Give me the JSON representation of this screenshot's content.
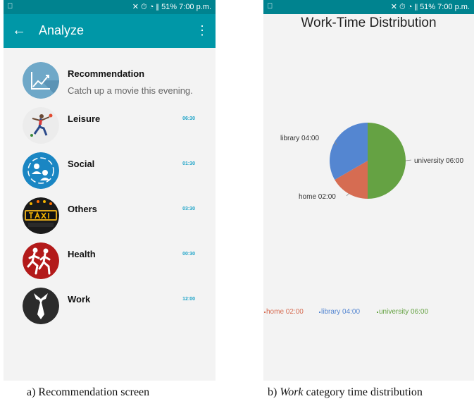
{
  "left_screen": {
    "status_bar": {
      "left": "⎕",
      "right": "✕ ⏱ ◔ ⫴ 51% 7:00 p.m."
    },
    "app_bar": {
      "back": "←",
      "title": "Analyze",
      "menu": "⋮"
    },
    "items": [
      {
        "title": "Recommendation",
        "subtitle": "Catch up a movie this evening.",
        "icon": "trend-chart-icon"
      },
      {
        "title": "Leisure",
        "time": "06:30",
        "icon": "leisure-icon"
      },
      {
        "title": "Social",
        "time": "01:30",
        "icon": "social-icon"
      },
      {
        "title": "Others",
        "time": "03:30",
        "icon": "taxi-icon"
      },
      {
        "title": "Health",
        "time": "00:30",
        "icon": "runners-icon"
      },
      {
        "title": "Work",
        "time": "12:00",
        "icon": "tie-icon"
      }
    ],
    "caption": "a) Recommendation screen"
  },
  "right_screen": {
    "status_bar": {
      "left": "⎕",
      "right": "✕ ⏱ ◔ ⫴ 51% 7:00 p.m."
    },
    "caption_prefix": "b) ",
    "caption_em": "Work",
    "caption_suffix": " category time distribution"
  },
  "chart_data": {
    "type": "pie",
    "title": "Work-Time Distribution",
    "categories": [
      "university",
      "home",
      "library"
    ],
    "values": [
      6,
      2,
      4
    ],
    "slice_labels": [
      "university 06:00",
      "home 02:00",
      "library 04:00"
    ],
    "colors": [
      "#65a243",
      "#d66c52",
      "#5486d1"
    ],
    "legend": {
      "placement": "bottom",
      "entries": [
        {
          "label": "home 02:00",
          "color": "#d66c52"
        },
        {
          "label": "library 04:00",
          "color": "#5486d1"
        },
        {
          "label": "university 06:00",
          "color": "#65a243"
        }
      ]
    }
  }
}
